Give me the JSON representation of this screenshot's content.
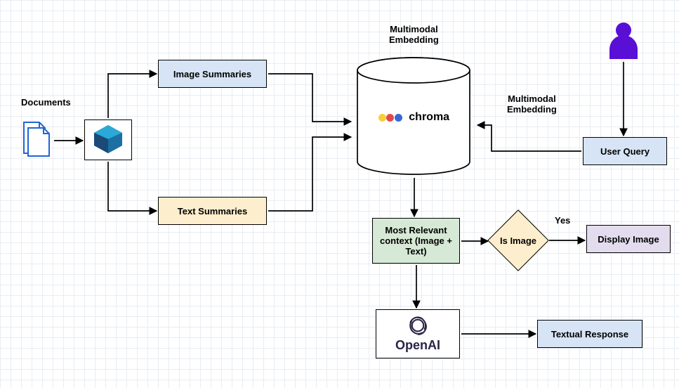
{
  "labels": {
    "documents": "Documents",
    "multimodal_embedding_top": "Multimodal\nEmbedding",
    "multimodal_embedding_right": "Multimodal\nEmbedding",
    "yes": "Yes"
  },
  "nodes": {
    "image_summaries": "Image Summaries",
    "text_summaries": "Text Summaries",
    "chroma": "chroma",
    "user_query": "User Query",
    "most_relevant": "Most Relevant context (Image + Text)",
    "is_image": "Is Image",
    "display_image": "Display Image",
    "openai": "OpenAI",
    "textual_response": "Textual Response"
  },
  "icons": {
    "documents": "documents-icon",
    "unstructured": "unstructured-logo",
    "chroma": "chroma-logo",
    "user": "user-icon",
    "openai": "openai-logo"
  }
}
